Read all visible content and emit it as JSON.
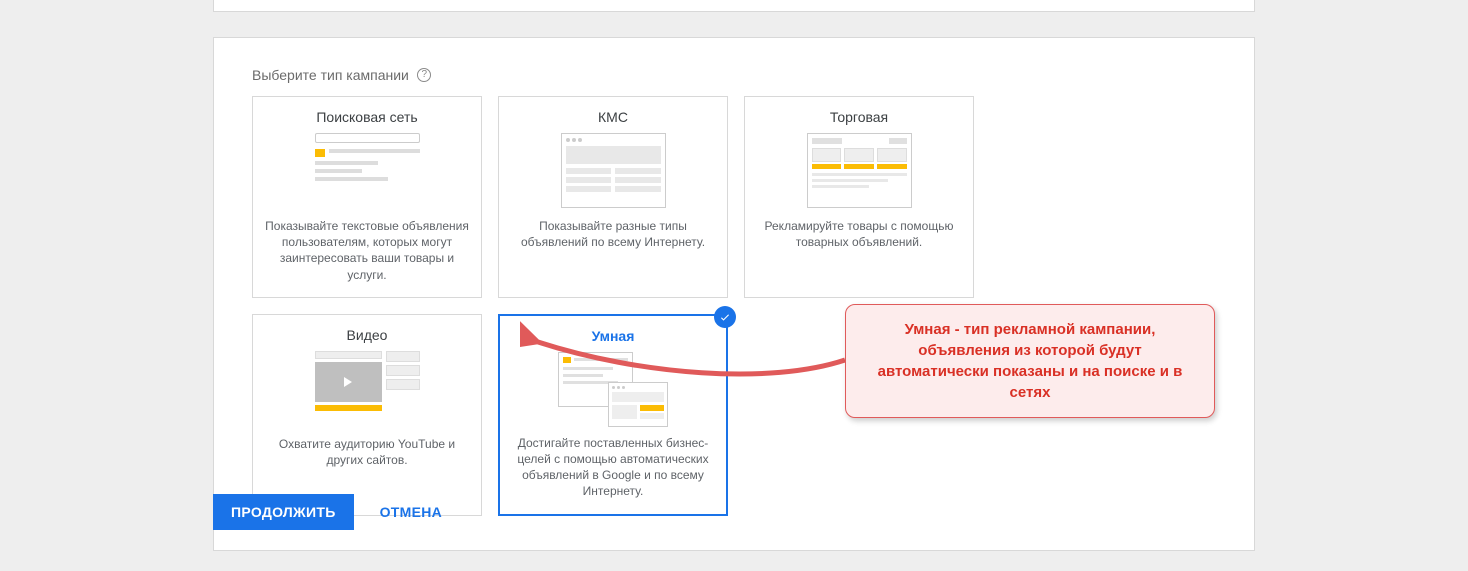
{
  "section": {
    "title": "Выберите тип кампании"
  },
  "cards": {
    "search": {
      "title": "Поисковая сеть",
      "desc": "Показывайте текстовые объявления пользователям, которых могут заинтересовать ваши товары и услуги."
    },
    "display": {
      "title": "КМС",
      "desc": "Показывайте разные типы объявлений по всему Интернету."
    },
    "shopping": {
      "title": "Торговая",
      "desc": "Рекламируйте товары с помощью товарных объявлений."
    },
    "video": {
      "title": "Видео",
      "desc": "Охватите аудиторию YouTube и других сайтов."
    },
    "smart": {
      "title": "Умная",
      "desc": "Достигайте поставленных бизнес-целей с помощью автоматических объявлений в Google и по всему Интернету."
    }
  },
  "buttons": {
    "continue": "ПРОДОЛЖИТЬ",
    "cancel": "ОТМЕНА"
  },
  "annotation": {
    "text": "Умная - тип рекламной кампании, объявления из которой будут автоматически показаны и на поиске и в сетях"
  },
  "help_icon": "?"
}
